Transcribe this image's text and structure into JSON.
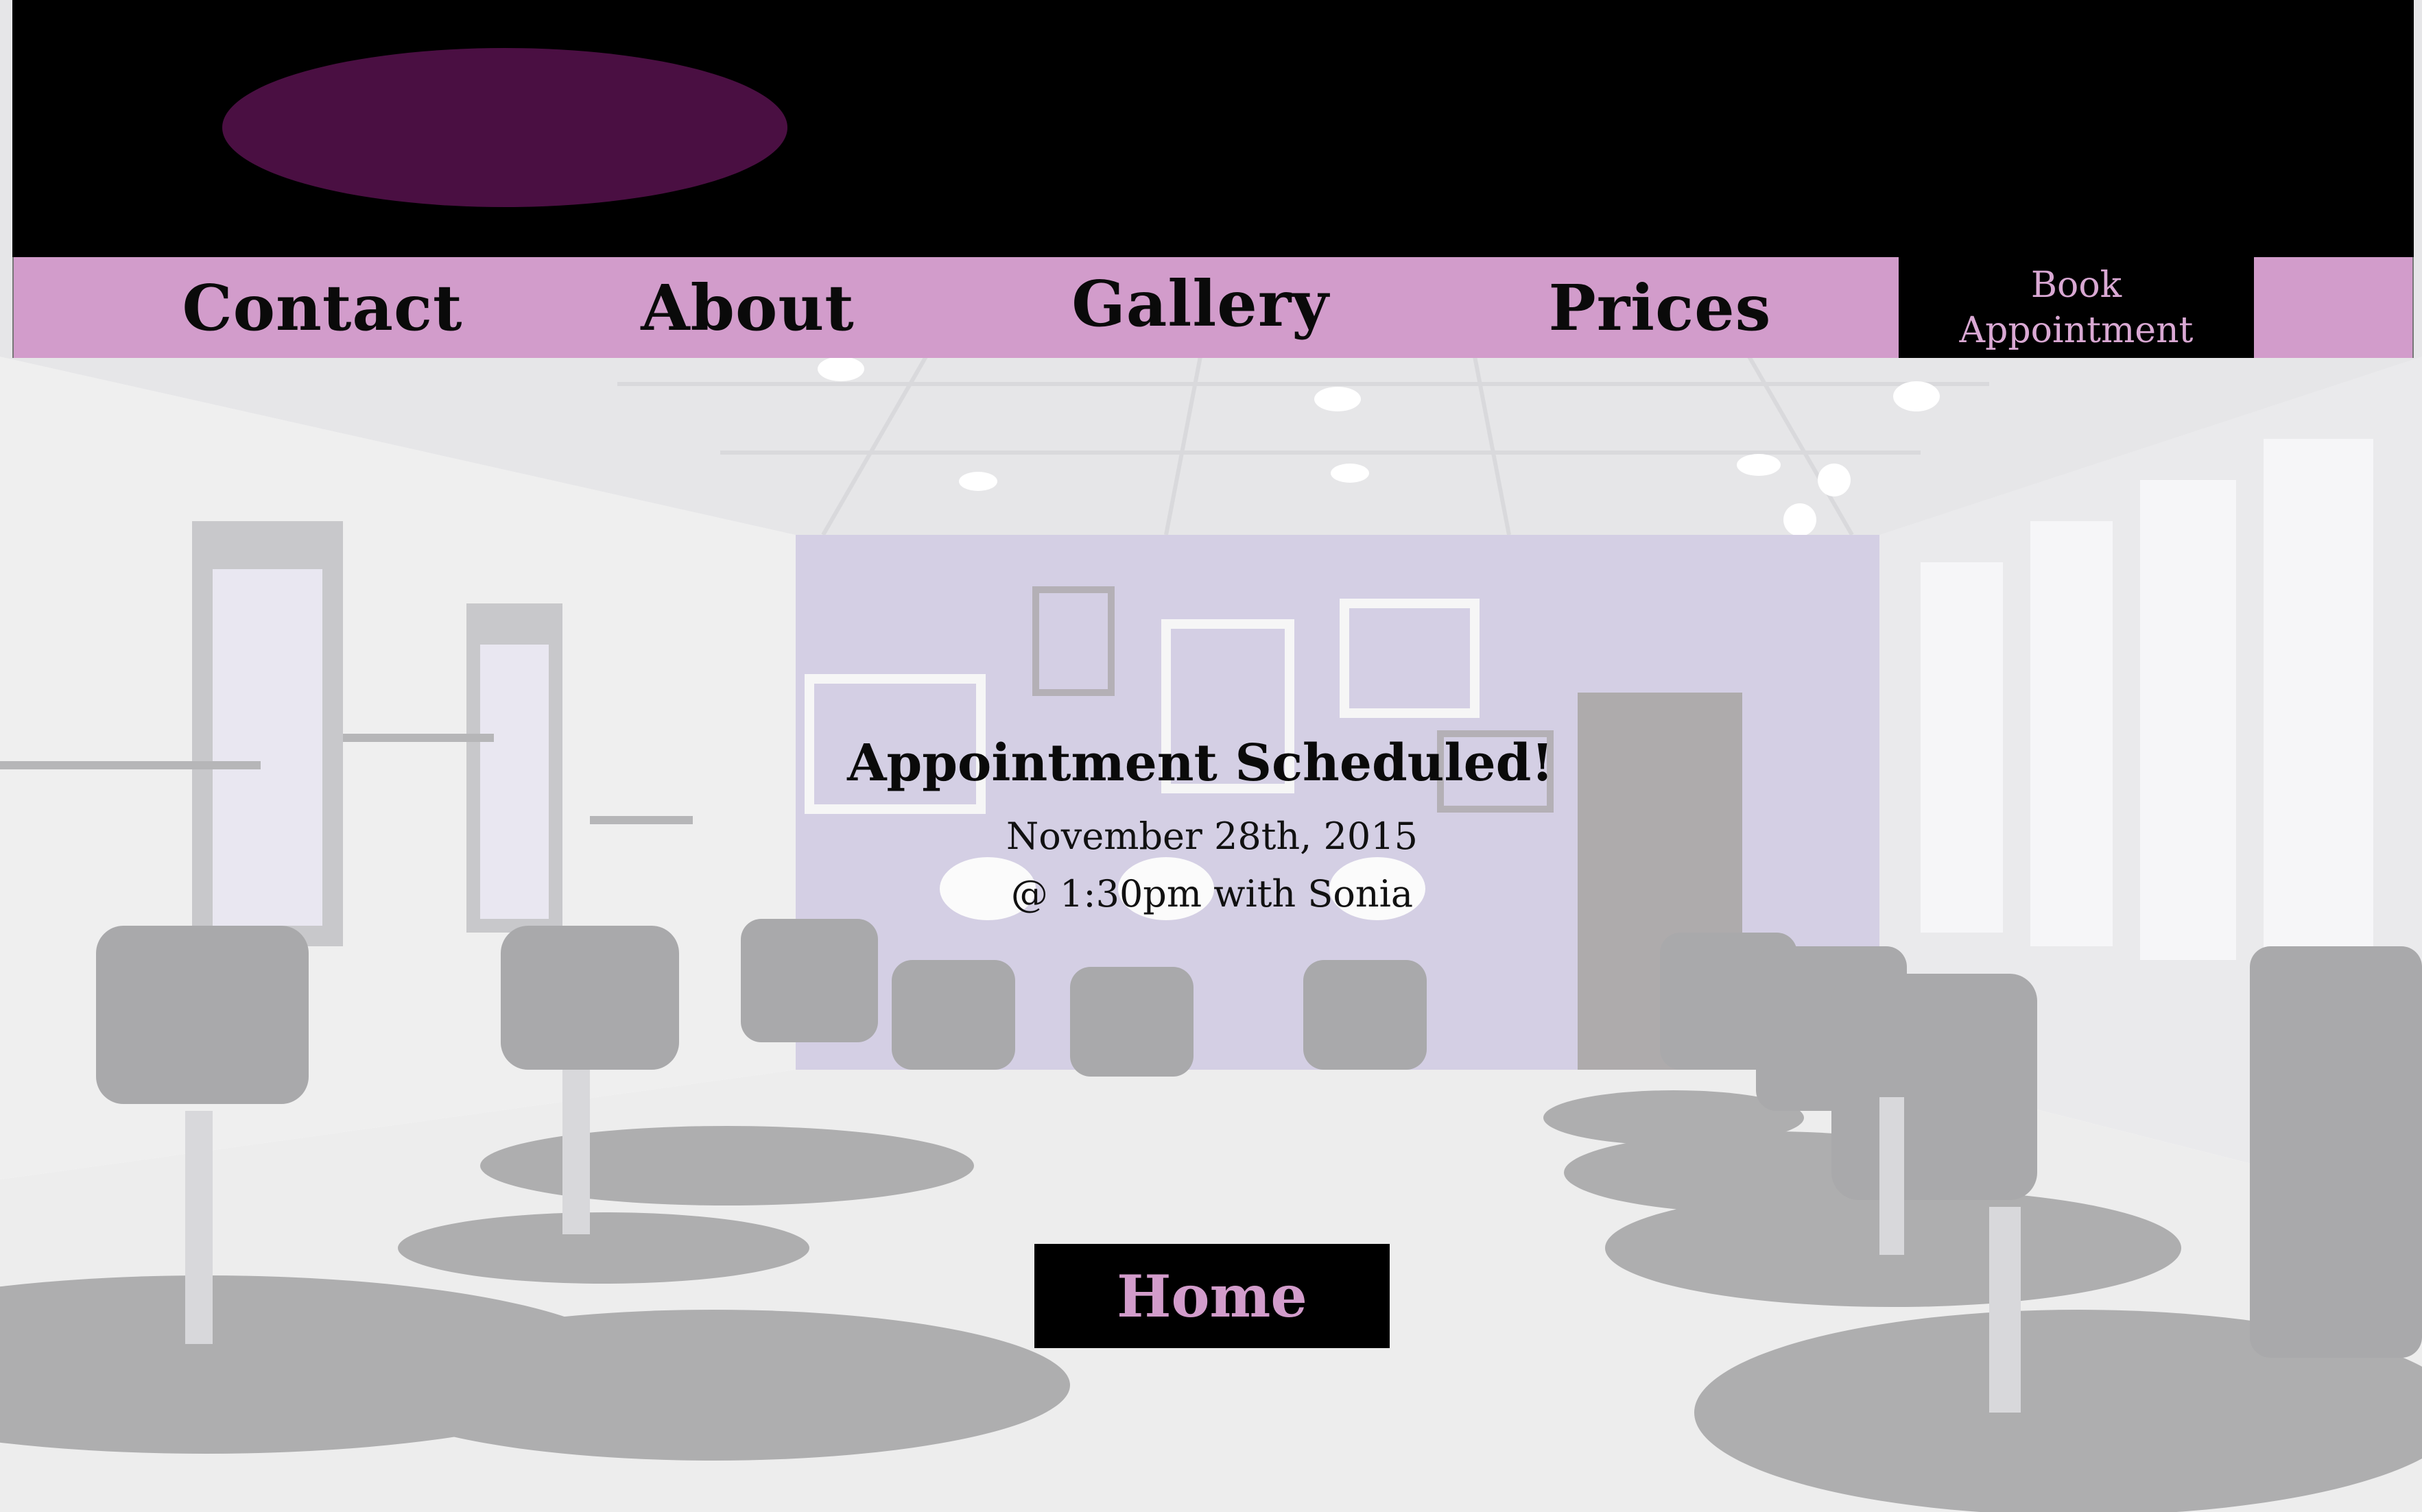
{
  "colors": {
    "header_bg": "#000000",
    "logo": "#4a0f42",
    "nav_bg": "#d29ccb",
    "nav_text": "#0a0a0a",
    "book_bg": "#000000",
    "book_text": "#d9a8d3",
    "home_text": "#d29ccb",
    "wall_accent": "#cfc4e6"
  },
  "nav": {
    "items": [
      {
        "label": "Contact"
      },
      {
        "label": "About"
      },
      {
        "label": "Gallery"
      },
      {
        "label": "Prices"
      }
    ],
    "book": {
      "line1": "Book",
      "line2": "Appointment"
    }
  },
  "confirmation": {
    "title": "Appointment Scheduled!",
    "date": "November 28th, 2015",
    "time": "@ 1:30pm with Sonia"
  },
  "home_button": {
    "label": "Home"
  }
}
